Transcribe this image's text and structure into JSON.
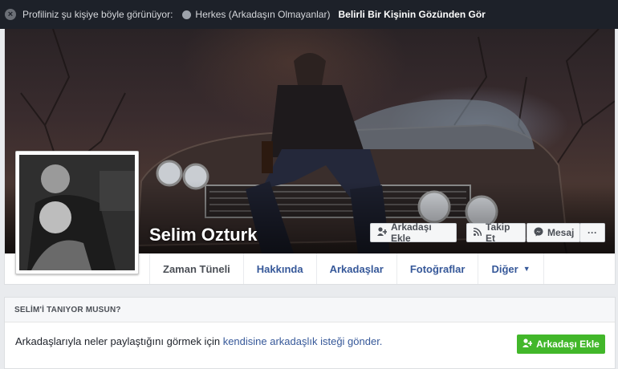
{
  "topbar": {
    "close_symbol": "×",
    "prefix": "Profiliniz şu kişiye böyle görünüyor:",
    "audience": "Herkes (Arkadaşın Olmayanlar)",
    "view_as": "Belirli Bir Kişinin Gözünden Gör"
  },
  "profile": {
    "name": "Selim Ozturk"
  },
  "actions": {
    "add_friend": "Arkadaşı Ekle",
    "follow": "Takip Et",
    "message": "Mesaj",
    "more": "···"
  },
  "tabs": [
    {
      "label": "Zaman Tüneli"
    },
    {
      "label": "Hakkında"
    },
    {
      "label": "Arkadaşlar"
    },
    {
      "label": "Fotoğraflar"
    },
    {
      "label": "Diğer"
    }
  ],
  "know_box": {
    "title": "SELİM'İ TANIYOR MUSUN?",
    "text": "Arkadaşlarıyla neler paylaştığını görmek için ",
    "link": "kendisine arkadaşlık isteği gönder.",
    "button": "Arkadaşı Ekle"
  },
  "icons": {
    "close": "close-icon",
    "globe": "globe-icon",
    "add_friend": "add-friend-icon",
    "follow": "rss-icon",
    "message": "messenger-icon",
    "caret": "caret-down-icon"
  },
  "colors": {
    "link": "#365899",
    "green_button": "#42b72a",
    "topbar": "#1d2129"
  }
}
